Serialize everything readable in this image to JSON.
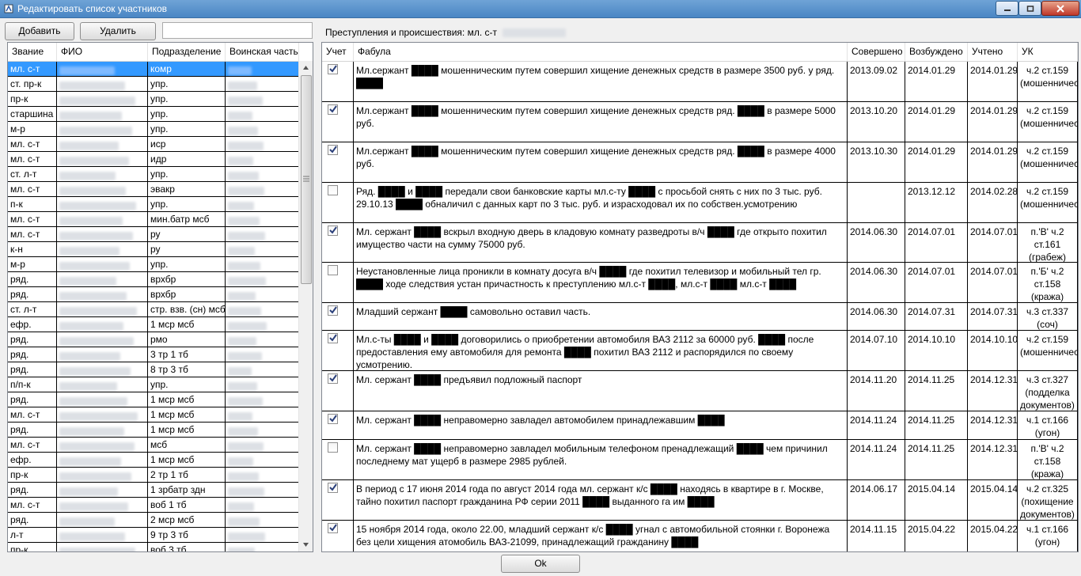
{
  "window": {
    "title": "Редактировать список участников"
  },
  "toolbar": {
    "add_label": "Добавить",
    "delete_label": "Удалить",
    "search_value": ""
  },
  "crimes_caption": "Преступления и происшествия: мл. с-т",
  "left_table": {
    "headers": [
      "Звание",
      "ФИО",
      "Подразделение",
      "Воинская часть"
    ],
    "rows": [
      {
        "rank": "мл. с-т",
        "unit": "комр"
      },
      {
        "rank": "ст. пр-к",
        "unit": "упр."
      },
      {
        "rank": "пр-к",
        "unit": "упр."
      },
      {
        "rank": "старшина",
        "unit": "упр."
      },
      {
        "rank": "м-р",
        "unit": "упр."
      },
      {
        "rank": "мл. с-т",
        "unit": "иср"
      },
      {
        "rank": "мл. с-т",
        "unit": "идр"
      },
      {
        "rank": "ст. л-т",
        "unit": "упр."
      },
      {
        "rank": "мл. с-т",
        "unit": "эвакр"
      },
      {
        "rank": "п-к",
        "unit": "упр."
      },
      {
        "rank": "мл. с-т",
        "unit": "мин.батр мсб"
      },
      {
        "rank": "мл. с-т",
        "unit": "ру"
      },
      {
        "rank": "к-н",
        "unit": "ру"
      },
      {
        "rank": "м-р",
        "unit": "упр."
      },
      {
        "rank": "ряд.",
        "unit": "врхбр"
      },
      {
        "rank": "ряд.",
        "unit": "врхбр"
      },
      {
        "rank": "ст. л-т",
        "unit": "стр. взв. (сн) мсб"
      },
      {
        "rank": "ефр.",
        "unit": "1 мср мсб"
      },
      {
        "rank": "ряд.",
        "unit": "рмо"
      },
      {
        "rank": "ряд.",
        "unit": "3 тр 1 тб"
      },
      {
        "rank": "ряд.",
        "unit": "8 тр 3 тб"
      },
      {
        "rank": "п/п-к",
        "unit": "упр."
      },
      {
        "rank": "ряд.",
        "unit": "1 мср мсб"
      },
      {
        "rank": "мл. с-т",
        "unit": "1 мср мсб"
      },
      {
        "rank": "ряд.",
        "unit": "1 мср мсб"
      },
      {
        "rank": "мл. с-т",
        "unit": "мсб"
      },
      {
        "rank": "ефр.",
        "unit": "1 мср мсб"
      },
      {
        "rank": "пр-к",
        "unit": "2 тр 1 тб"
      },
      {
        "rank": "ряд.",
        "unit": "1 зрбатр здн"
      },
      {
        "rank": "мл. с-т",
        "unit": "воб 1 тб"
      },
      {
        "rank": "ряд.",
        "unit": "2 мср мсб"
      },
      {
        "rank": "л-т",
        "unit": "9 тр 3 тб"
      },
      {
        "rank": "пр-к",
        "unit": "воб 3 тб"
      }
    ]
  },
  "right_table": {
    "headers": [
      "Учет",
      "Фабула",
      "Совершено",
      "Возбуждено",
      "Учтено",
      "УК"
    ],
    "rows": [
      {
        "checked": true,
        "fabula": "Мл.сержант ████ мошенническим путем совершил хищение денежных средств в размере 3500 руб. у ряд. ████",
        "done": "2013.09.02",
        "initiated": "2014.01.29",
        "registered": "2014.01.29",
        "uk": "ч.2 ст.159 (мошенничество)"
      },
      {
        "checked": true,
        "fabula": "Мл.сержант ████ мошенническим путем совершил хищение денежных средств ряд. ████ в размере 5000 руб.",
        "done": "2013.10.20",
        "initiated": "2014.01.29",
        "registered": "2014.01.29",
        "uk": "ч.2 ст.159 (мошенничество)"
      },
      {
        "checked": true,
        "fabula": "Мл.сержант ████ мошенническим путем совершил хищение денежных средств ряд. ████ в размере 4000 руб.",
        "done": "2013.10.30",
        "initiated": "2014.01.29",
        "registered": "2014.01.29",
        "uk": "ч.2 ст.159 (мошенничество)"
      },
      {
        "checked": false,
        "fabula": "Ряд. ████ и ████ передали свои банковские карты мл.с-ту ████ с просьбой снять с них по 3 тыс. руб. 29.10.13 ████ обналичил с данных карт по 3 тыс. руб. и израсходовал их по собствен.усмотрению",
        "done": "",
        "initiated": "2013.12.12",
        "registered": "2014.02.28",
        "uk": "ч.2 ст.159 (мошенничество)"
      },
      {
        "checked": true,
        "fabula": "Мл. сержант ████ вскрыл входную дверь в кладовую комнату разведроты в/ч ████ где открыто похитил имущество части на сумму 75000 руб.",
        "done": "2014.06.30",
        "initiated": "2014.07.01",
        "registered": "2014.07.01",
        "uk": "п.'В' ч.2 ст.161 (грабеж)"
      },
      {
        "checked": false,
        "fabula": "Неустановленные лица проникли в комнату досуга в/ч ████ где похитил телевизор и мобильный тел гр. ████ ходе следствия устан причастность к преступлению мл.с-т ████, мл.с-т ████ мл.с-т ████",
        "done": "2014.06.30",
        "initiated": "2014.07.01",
        "registered": "2014.07.01",
        "uk": "п.'Б' ч.2 ст.158 (кража)"
      },
      {
        "checked": true,
        "fabula": "Младший сержант ████ самовольно оставил часть.",
        "done": "2014.06.30",
        "initiated": "2014.07.31",
        "registered": "2014.07.31",
        "uk": "ч.3 ст.337 (соч)"
      },
      {
        "checked": true,
        "fabula": "Мл.с-ты ████ и ████ договорились о приобретении автомобиля ВАЗ 2112 за 60000 руб. ████ после предоставления ему автомобиля для ремонта ████ похитил ВАЗ 2112 и распорядился по своему усмотрению.",
        "done": "2014.07.10",
        "initiated": "2014.10.10",
        "registered": "2014.10.10",
        "uk": "ч.2 ст.159 (мошенничество)"
      },
      {
        "checked": true,
        "fabula": "Мл. сержант ████ предъявил подложный паспорт",
        "done": "2014.11.20",
        "initiated": "2014.11.25",
        "registered": "2014.12.31",
        "uk": "ч.3 ст.327 (подделка документов)"
      },
      {
        "checked": true,
        "fabula": "Мл. сержант ████ неправомерно завладел автомобилем принадлежавшим ████",
        "done": "2014.11.24",
        "initiated": "2014.11.25",
        "registered": "2014.12.31",
        "uk": "ч.1 ст.166 (угон)"
      },
      {
        "checked": false,
        "fabula": "Мл. сержант ████ неправомерно завладел мобильным телефоном пренадлежащий ████ чем причинил последнему мат ущерб в размере 2985 рублей.",
        "done": "2014.11.24",
        "initiated": "2014.11.25",
        "registered": "2014.12.31",
        "uk": "п.'В' ч.2 ст.158 (кража)"
      },
      {
        "checked": true,
        "fabula": " В период с 17 июня 2014 года по август 2014 года мл. сержант к/с ████ находясь в квартире в г. Москве, тайно похитил паспорт гражданина РФ серии 2011 ████ выданного га им ████",
        "done": "2014.06.17",
        "initiated": "2015.04.14",
        "registered": "2015.04.14",
        "uk": "ч.2 ст.325 (похищение документов)"
      },
      {
        "checked": true,
        "fabula": "15 ноября 2014 года, около 22.00, младший сержант к/с ████ угнал с автомобильной стоянки г. Воронежа без цели хищения атомобиль ВАЗ-21099, принадлежащий гражданину ████",
        "done": "2014.11.15",
        "initiated": "2015.04.22",
        "registered": "2015.04.22",
        "uk": "ч.1 ст.166 (угон)"
      }
    ]
  },
  "ok_label": "Ok"
}
